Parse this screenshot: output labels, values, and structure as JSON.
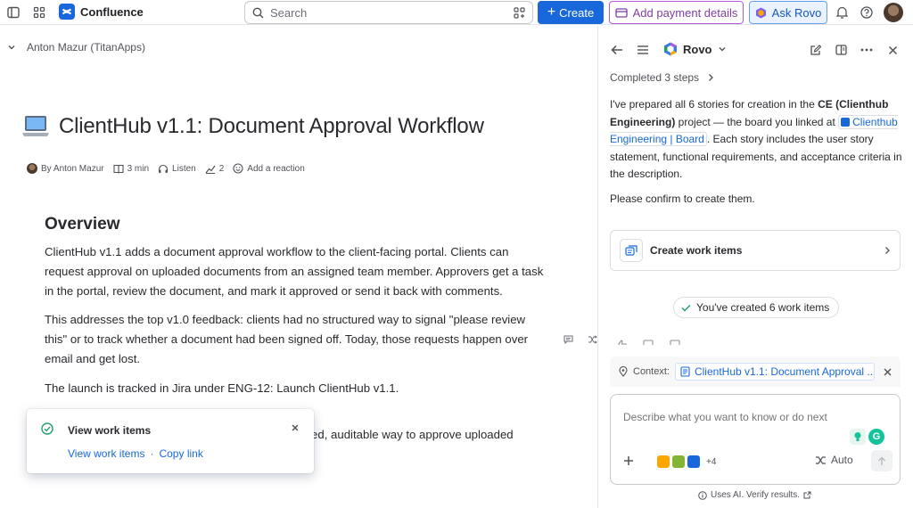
{
  "topbar": {
    "app_name": "Confluence",
    "search_placeholder": "Search",
    "create_label": "Create",
    "payment_label": "Add payment details",
    "ask_rovo_label": "Ask Rovo"
  },
  "page": {
    "space_owner": "Anton Mazur (TitanApps)",
    "emoji": "💻",
    "title": "ClientHub v1.1: Document Approval Workflow",
    "byline": {
      "author": "By Anton Mazur",
      "read_time": "3 min",
      "listen": "Listen",
      "views": "2",
      "reaction": "Add a reaction"
    },
    "heading": "Overview",
    "paragraphs": [
      "ClientHub v1.1 adds a document approval workflow to the client-facing portal. Clients can request approval on uploaded documents from an assigned team member. Approvers get a task in the portal, review the document, and mark it approved or send it back with comments.",
      "This addresses the top v1.0 feedback: clients had no structured way to signal \"please review this\" or to track whether a document had been signed off. Today, those requests happen over email and get lost.",
      "The launch is tracked in Jira under ENG-12: Launch ClientHub v1.1.",
      "Primary goal: give clients and internal teams a shared, auditable way to approve uploaded documents inside ClientHub."
    ]
  },
  "toast": {
    "title": "View work items",
    "action_view": "View work items",
    "separator": "·",
    "action_copy": "Copy link"
  },
  "rovo": {
    "title": "Rovo",
    "completed": "Completed 3 steps",
    "message": {
      "p1_a": "I've prepared all 6 stories for creation in the ",
      "project": "CE (Clienthub Engineering)",
      "p1_b": " project — the board you linked at ",
      "board_link": "Clienthub Engineering | Board",
      "p1_c": ". Each story includes the user story statement, functional requirements, and acceptance criteria in the description.",
      "p2": "Please confirm to create them."
    },
    "create_card_label": "Create work items",
    "created_pill": "You've created 6 work items",
    "context_label": "Context:",
    "context_chip": "ClientHub v1.1: Document Approval ...",
    "composer_placeholder": "Describe what you want to know or do next",
    "agents_more": "+4",
    "mode_label": "Auto",
    "ai_note": "Uses AI. Verify results."
  },
  "colors": {
    "brand_blue": "#1868DB",
    "payment_purple": "#803FA5",
    "success_green": "#22A06B"
  }
}
